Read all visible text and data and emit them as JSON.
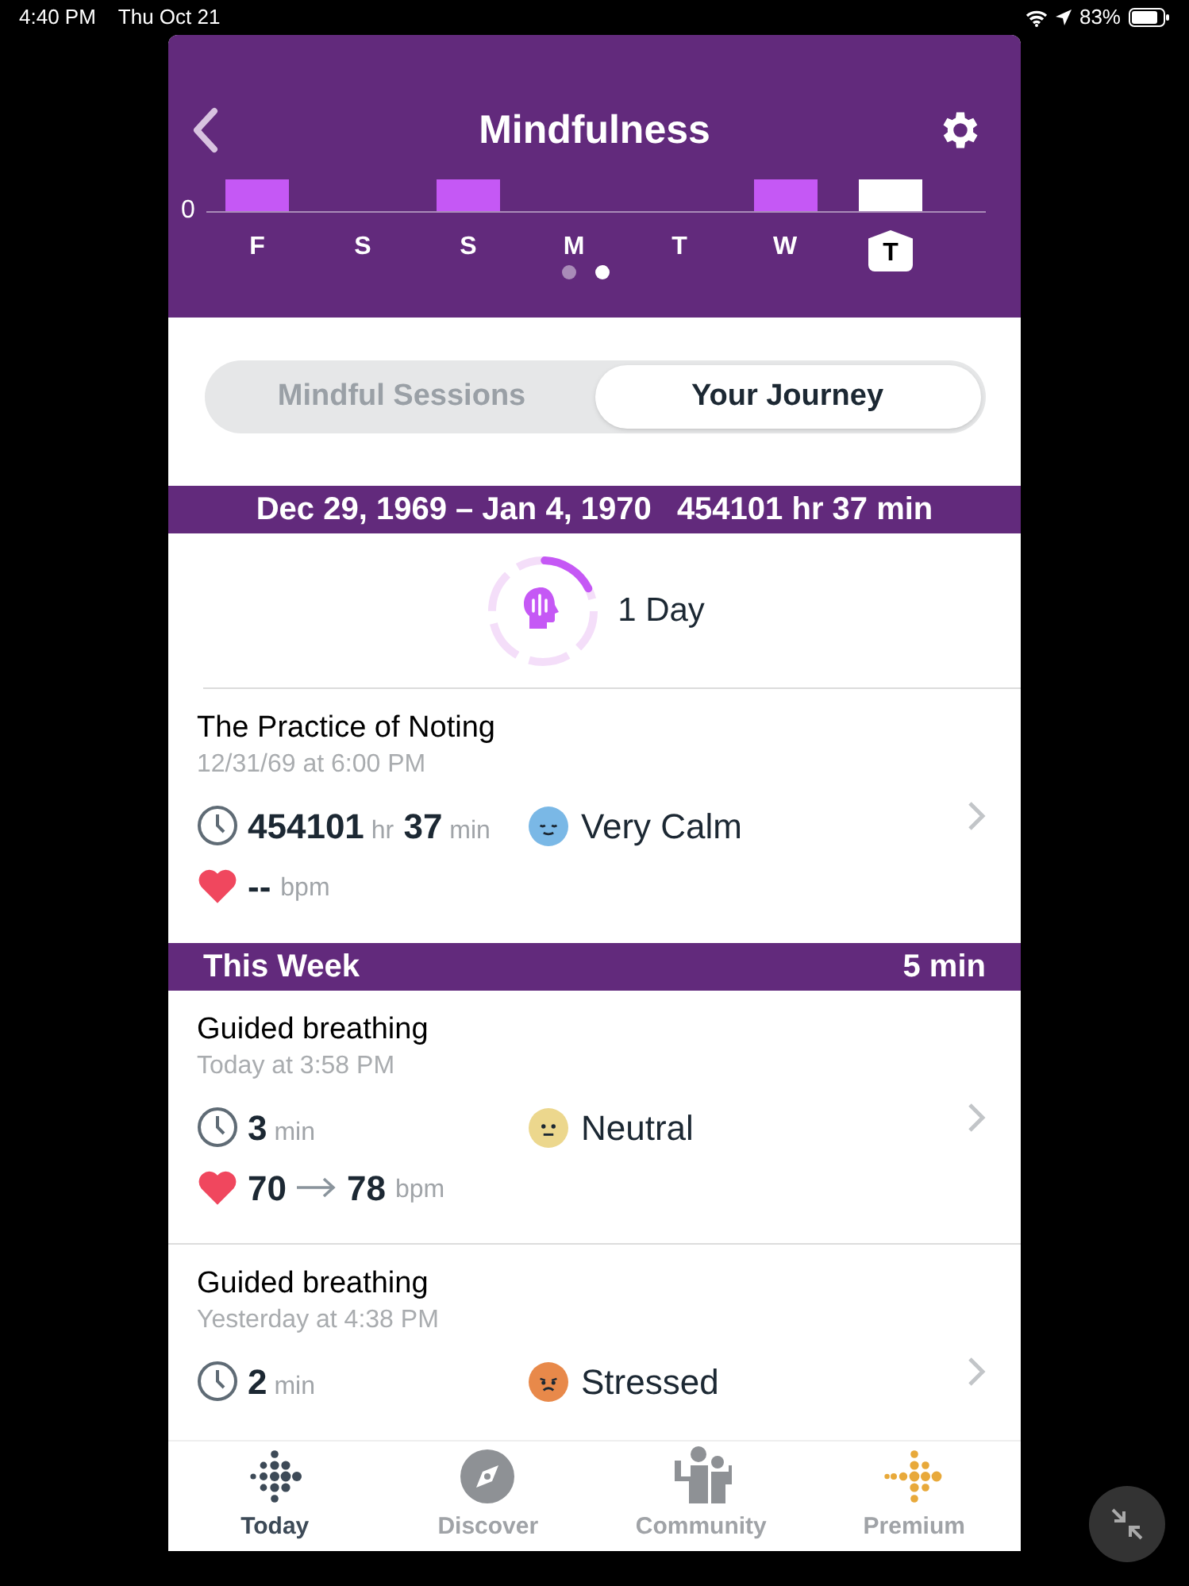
{
  "status_bar": {
    "time": "4:40 PM",
    "date": "Thu Oct 21",
    "battery": "83%"
  },
  "header": {
    "title": "Mindfulness"
  },
  "chart": {
    "axis_label": "0",
    "days": [
      {
        "label": "F",
        "has_session": true,
        "selected": false
      },
      {
        "label": "S",
        "has_session": false,
        "selected": false
      },
      {
        "label": "S",
        "has_session": true,
        "selected": false
      },
      {
        "label": "M",
        "has_session": false,
        "selected": false
      },
      {
        "label": "T",
        "has_session": false,
        "selected": false
      },
      {
        "label": "W",
        "has_session": true,
        "selected": false
      },
      {
        "label": "T",
        "has_session": true,
        "selected": true
      }
    ],
    "pages": [
      {
        "selected": false
      },
      {
        "selected": true
      }
    ]
  },
  "segments": [
    {
      "label": "Mindful Sessions",
      "selected": false
    },
    {
      "label": "Your Journey",
      "selected": true
    }
  ],
  "journey": {
    "range": "Dec 29, 1969 – Jan 4, 1970",
    "total": "454101 hr 37 min",
    "streak": "1 Day",
    "level": 0.17
  },
  "sessions": [
    {
      "title": "The Practice of Noting",
      "time": "12/31/69 at 6:00 PM",
      "duration": [
        {
          "value": "454101",
          "unit": "hr"
        },
        {
          "value": "37",
          "unit": "min"
        }
      ],
      "mood": {
        "kind": "very_calm",
        "label": "Very Calm"
      },
      "heart": {
        "values": [
          "--"
        ],
        "unit": "bpm"
      }
    }
  ],
  "week": {
    "title": "This Week",
    "total": "5 min",
    "sessions": [
      {
        "title": "Guided breathing",
        "time": "Today at 3:58 PM",
        "duration": [
          {
            "value": "3",
            "unit": "min"
          }
        ],
        "mood": {
          "kind": "neutral",
          "label": "Neutral"
        },
        "heart": {
          "values": [
            "70",
            "78"
          ],
          "unit": "bpm"
        }
      },
      {
        "title": "Guided breathing",
        "time": "Yesterday at 4:38 PM",
        "duration": [
          {
            "value": "2",
            "unit": "min"
          }
        ],
        "mood": {
          "kind": "stressed",
          "label": "Stressed"
        }
      }
    ]
  },
  "tabs": [
    {
      "kind": "today",
      "label": "Today",
      "selected": true
    },
    {
      "kind": "discover",
      "label": "Discover",
      "selected": false
    },
    {
      "kind": "community",
      "label": "Community",
      "selected": false
    },
    {
      "kind": "premium",
      "label": "Premium",
      "selected": false
    }
  ]
}
